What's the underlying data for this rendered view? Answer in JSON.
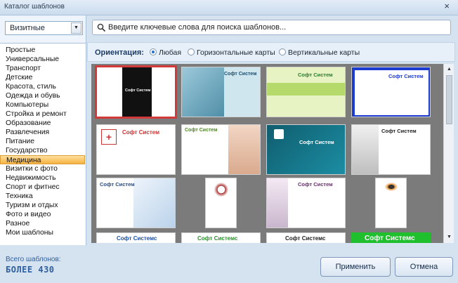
{
  "window": {
    "title": "Каталог шаблонов",
    "close_glyph": "×"
  },
  "sidebar": {
    "combo_value": "Визитные",
    "items": [
      "Простые",
      "Универсальные",
      "Транспорт",
      "Детские",
      "Красота, стиль",
      "Одежда и обувь",
      "Компьютеры",
      "Стройка и ремонт",
      "Образование",
      "Развлечения",
      "Питание",
      "Государство",
      "Медицина",
      "Визитки с фото",
      "Недвижимость",
      "Спорт и фитнес",
      "Техника",
      "Туризм и отдых",
      "Фото и видео",
      "Разное",
      "Мои шаблоны"
    ],
    "selected_index": 12
  },
  "search": {
    "placeholder": "Введите ключевые слова для поиска шаблонов..."
  },
  "orientation": {
    "label": "Ориентация:",
    "options": [
      "Любая",
      "Горизонтальные карты",
      "Вертикальные карты"
    ],
    "selected": 0
  },
  "cards": {
    "brand1": "Софт Систем",
    "brand2": "Софт Системс",
    "selected_index": 0
  },
  "footer": {
    "count_label": "Всего шаблонов:",
    "count_value": "БОЛЕЕ 430",
    "apply": "Применить",
    "cancel": "Отмена"
  },
  "colors": {
    "accent": "#2d5fa0",
    "selection": "#f5b340",
    "blue_card": "#1b3bd1",
    "green_card": "#1fbf2d"
  }
}
